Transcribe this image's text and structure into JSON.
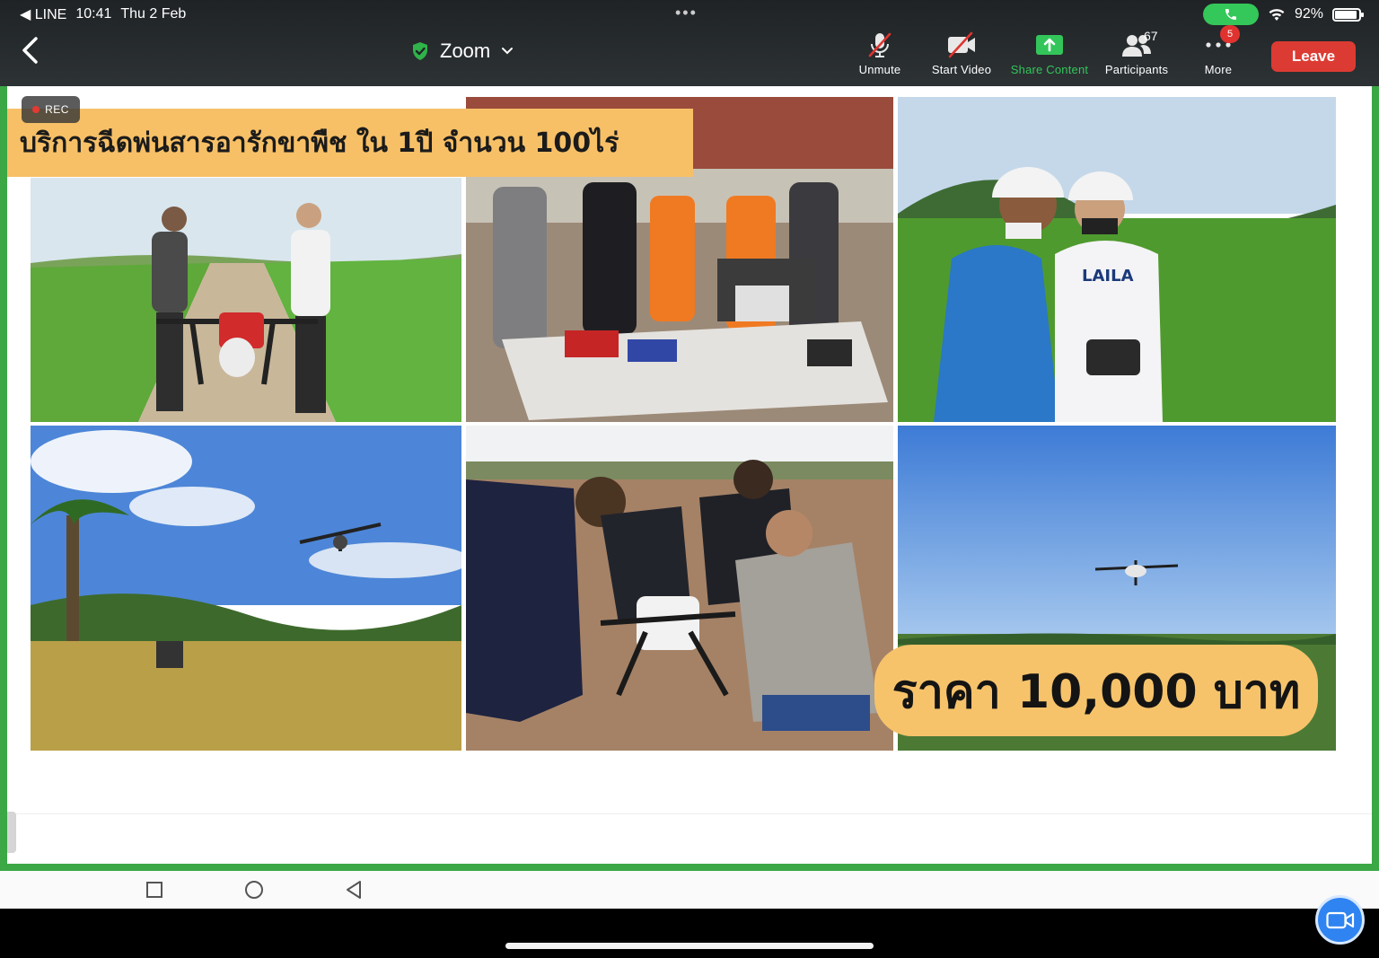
{
  "status_bar": {
    "back_app": "◀ LINE",
    "time": "10:41",
    "date": "Thu 2 Feb",
    "battery": "92%",
    "battery_level": 0.92
  },
  "toolbar": {
    "meeting_title": "Zoom",
    "unmute_label": "Unmute",
    "start_video_label": "Start Video",
    "share_content_label": "Share Content",
    "participants_label": "Participants",
    "participants_count": "67",
    "more_label": "More",
    "more_badge": "5",
    "leave_label": "Leave"
  },
  "recording": {
    "label": "REC"
  },
  "slide": {
    "title": "บริการฉีดพ่นสารอารักขาพืช ใน 1ปี จำนวน 100ไร่",
    "price": "ราคา 10,000 บาท",
    "shirt_logo": "LAILA",
    "colors": {
      "title_bg": "#f7c067",
      "price_bg": "#f6c36b",
      "frame": "#3ba845"
    }
  },
  "colors": {
    "leave": "#dc3b33",
    "share_accent": "#33c55a",
    "badge": "#e0332f",
    "fab": "#2f84f1"
  },
  "icons": [
    "back-chevron",
    "shield-check",
    "mic-off",
    "video-off",
    "share-up-arrow",
    "participants",
    "more-dots",
    "square",
    "circle",
    "triangle-back",
    "video-camera"
  ]
}
